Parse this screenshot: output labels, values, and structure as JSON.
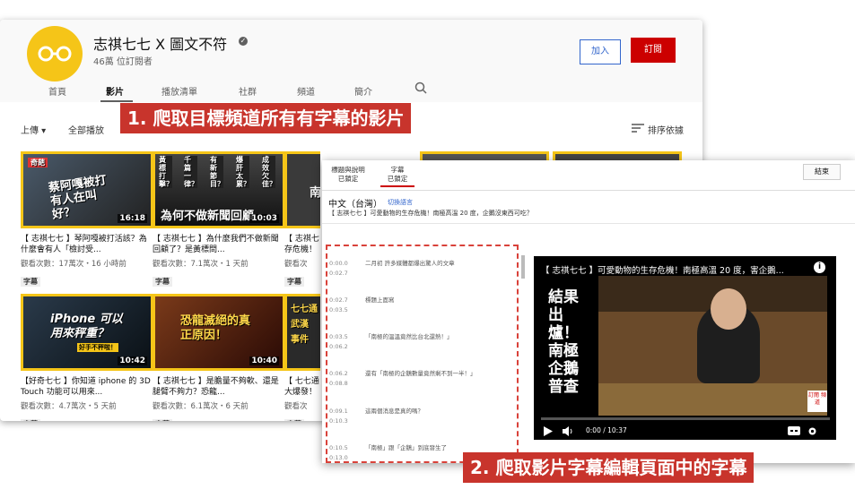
{
  "channel": {
    "name": "志祺七七 X 圖文不符",
    "subscribers": "46萬 位訂閱者",
    "join_label": "加入",
    "subscribe_label": "訂閱"
  },
  "tabs": [
    "首頁",
    "影片",
    "播放清單",
    "社群",
    "頻道",
    "簡介"
  ],
  "toolbar": {
    "uploads_label": "上傳 ▾",
    "play_all_label": "全部播放",
    "sort_label": "排序依據"
  },
  "videos": [
    {
      "title": "【 志祺七七 】琴阿嘎被打活該？為什麼會有人「檢討受...",
      "meta": "觀看次數：17萬次・16 小時前",
      "cc": "字幕",
      "duration": "16:18",
      "thumb_text": "蔡阿嘎被打 有人在叫好？",
      "badge": "奇葩"
    },
    {
      "title": "【 志祺七七 】為什麼我們不做新聞回顧了？是黃標問...",
      "meta": "觀看次數：7.1萬次・1 天前",
      "cc": "字幕",
      "duration": "10:03",
      "thumb_text": "為何不做新聞回顧",
      "badges": [
        "黃標打擊？",
        "千篇一律？",
        "有新節目？",
        "爆肝太累？",
        "成效欠佳？"
      ]
    },
    {
      "title": "【 志祺七 存危機！",
      "meta": "觀看次",
      "cc": "字幕",
      "duration": "",
      "thumb_text": "南"
    },
    {
      "title": "【好奇七七 】你知道 iphone 的 3D Touch 功能可以用來...",
      "meta": "觀看次數：4.7萬次・5 天前",
      "cc": "字幕",
      "duration": "10:42",
      "thumb_text": "iPhone 可以用來秤重？",
      "badge": "好手不秤啦！"
    },
    {
      "title": "【 志祺七七 】是膽量不夠軟、還是腿臂不夠力？恐龍...",
      "meta": "觀看次數：6.1萬次・6 天前",
      "cc": "字幕",
      "duration": "10:40",
      "thumb_text": "恐龍滅絕的真正原因！"
    },
    {
      "title": "【 七七通 大爆發！",
      "meta": "觀看次",
      "cc": "字幕",
      "duration": "",
      "thumb_text": "七七通 武漢 事件"
    }
  ],
  "editor": {
    "tab_info": "標題與說明\n已鎖定",
    "tab_subs": "字幕\n已鎖定",
    "close_label": "結束",
    "language": "中文（台灣）",
    "switch_language": "切換語言",
    "video_title": "【 志祺七七 】可愛動物的生存危機！南極高溫 20 度，企鵝沒東西可吃？",
    "cues": [
      {
        "start": "0:00.0",
        "end": "0:02.7",
        "text": "二月初 許多媒體都爆出驚人的文章"
      },
      {
        "start": "0:02.7",
        "end": "0:03.5",
        "text": "標題上面寫"
      },
      {
        "start": "0:03.5",
        "end": "0:06.2",
        "text": "「南極的溫溫竟然比台北還熱！」"
      },
      {
        "start": "0:06.2",
        "end": "0:08.8",
        "text": "還有「南極的企鵝數量竟然剩不到一半！」"
      },
      {
        "start": "0:09.1",
        "end": "0:10.3",
        "text": "這兩個消息是真的嗎？"
      },
      {
        "start": "0:10.5",
        "end": "0:13.0",
        "text": "「南極」跟「企鵝」到底發生了"
      }
    ],
    "player": {
      "title": "【 志祺七七 】可愛動物的生存危機！南極高溫 20 度，害企鵝...",
      "vertical_caption": "結果出爐！南極企鵝普查",
      "time": "0:00 / 10:37",
      "tag": "訂閱 頻道"
    }
  },
  "annotations": {
    "step1": "1. 爬取目標頻道所有有字幕的影片",
    "step2": "2. 爬取影片字幕編輯頁面中的字幕"
  },
  "colors": {
    "brand_yellow": "#f5c518",
    "youtube_red": "#cc0000",
    "annotation_red": "#c8342c"
  }
}
